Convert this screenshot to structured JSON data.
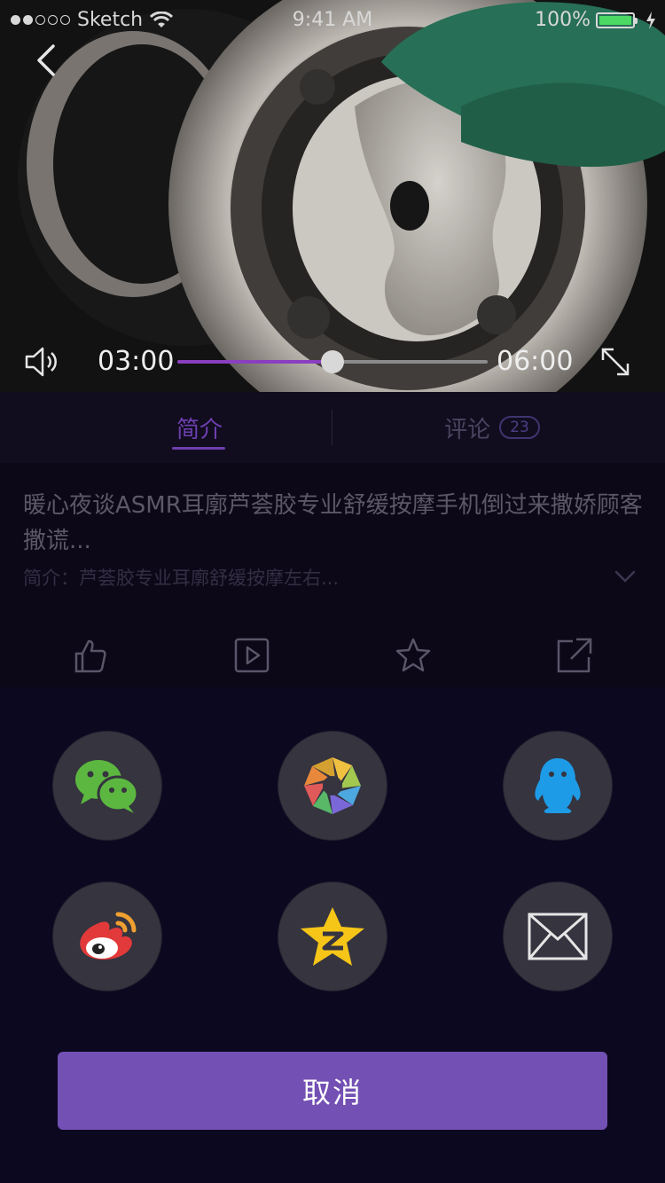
{
  "status_bar": {
    "carrier": "Sketch",
    "time": "9:41 AM",
    "battery": "100%"
  },
  "player": {
    "current_time": "03:00",
    "duration": "06:00",
    "progress_fraction": 0.5
  },
  "tabs": {
    "intro_label": "简介",
    "comments_label": "评论",
    "comments_count": "23"
  },
  "video_info": {
    "title": "暖心夜谈ASMR耳廓芦荟胶专业舒缓按摩手机倒过来撒娇顾客撒谎...",
    "description": "简介：芦荟胶专业耳廓舒缓按摩左右..."
  },
  "actions": [
    {
      "icon": "thumbs-up-icon",
      "count": ""
    },
    {
      "icon": "play-icon",
      "count": ""
    },
    {
      "icon": "star-icon",
      "count": ""
    },
    {
      "icon": "share-icon",
      "count": ""
    }
  ],
  "share_targets": [
    {
      "name": "wechat",
      "icon": "wechat-icon"
    },
    {
      "name": "moments",
      "icon": "moments-icon"
    },
    {
      "name": "qq",
      "icon": "qq-icon"
    },
    {
      "name": "weibo",
      "icon": "weibo-icon"
    },
    {
      "name": "qzone",
      "icon": "qzone-icon"
    },
    {
      "name": "email",
      "icon": "mail-icon"
    }
  ],
  "cancel_label": "取消",
  "colors": {
    "accent": "#7350b3",
    "progress": "#8a3fbf",
    "tab_active": "#6e3fb0",
    "battery": "#4cd964"
  }
}
